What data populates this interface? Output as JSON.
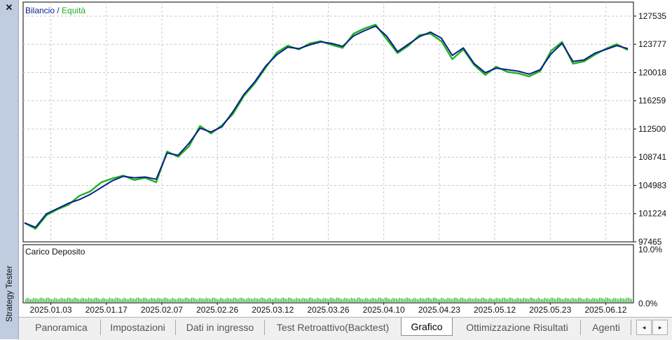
{
  "panel": {
    "title": "Strategy Tester",
    "close_icon": "close-icon"
  },
  "chart_data": [
    {
      "type": "line",
      "legend": {
        "balance_label": "Bilancio",
        "separator": " / ",
        "equity_label": "Equità",
        "placement": "top-left"
      },
      "series_colors": {
        "balance": "#0b1f8c",
        "equity": "#1eb21e"
      },
      "yticks": [
        "127535",
        "123777",
        "120018",
        "116259",
        "112500",
        "108741",
        "104983",
        "101224",
        "97465"
      ],
      "ylim": [
        97465,
        129400
      ],
      "grid": true,
      "series": [
        {
          "name": "Bilancio",
          "values": [
            100000,
            99400,
            101200,
            101900,
            102600,
            103100,
            103800,
            104700,
            105600,
            106200,
            106000,
            106100,
            105800,
            109300,
            109000,
            110600,
            112600,
            112100,
            112800,
            114800,
            117100,
            118800,
            120900,
            122400,
            123400,
            123200,
            123700,
            124100,
            123900,
            123500,
            124900,
            125600,
            126200,
            124900,
            122800,
            123800,
            124800,
            125400,
            124600,
            122300,
            123300,
            121200,
            120000,
            120600,
            120400,
            120200,
            119800,
            120400,
            122500,
            123900,
            121500,
            121700,
            122600,
            123100,
            123600,
            123200
          ]
        },
        {
          "name": "Equità",
          "values": [
            100000,
            99200,
            101000,
            101800,
            102400,
            103600,
            104200,
            105400,
            105900,
            106300,
            105700,
            106000,
            105400,
            109500,
            108800,
            110200,
            112900,
            111900,
            113000,
            114500,
            116900,
            118600,
            120700,
            122700,
            123600,
            123100,
            123900,
            124200,
            123700,
            123300,
            125200,
            125900,
            126400,
            124500,
            122600,
            123600,
            125000,
            125200,
            124200,
            121800,
            123100,
            121000,
            119700,
            120800,
            120100,
            119900,
            119500,
            120200,
            122900,
            124100,
            121200,
            121500,
            122400,
            123200,
            123800,
            123000
          ]
        }
      ]
    },
    {
      "type": "bar",
      "title": "Carico Deposito",
      "yticks": [
        "10.0%",
        "0.0%"
      ],
      "ylim": [
        0,
        10
      ],
      "value_pct": 0.6,
      "color": "#1eb21e",
      "xticks": [
        "2025.01.03",
        "2025.01.17",
        "2025.02.07",
        "2025.02.26",
        "2025.03.12",
        "2025.03.26",
        "2025.04.10",
        "2025.04.23",
        "2025.05.12",
        "2025.05.23",
        "2025.06.12"
      ]
    }
  ],
  "tabs": [
    {
      "label": "Panoramica",
      "active": false
    },
    {
      "label": "Impostazioni",
      "active": false
    },
    {
      "label": "Dati in ingresso",
      "active": false
    },
    {
      "label": "Test Retroattivo(Backtest)",
      "active": false
    },
    {
      "label": "Grafico",
      "active": true
    },
    {
      "label": "Ottimizzazione Risultati",
      "active": false
    },
    {
      "label": "Agenti",
      "active": false
    }
  ],
  "nav": {
    "prev_icon": "arrow-left-icon",
    "next_icon": "arrow-right-icon",
    "prev_glyph": "◂",
    "next_glyph": "▸"
  }
}
